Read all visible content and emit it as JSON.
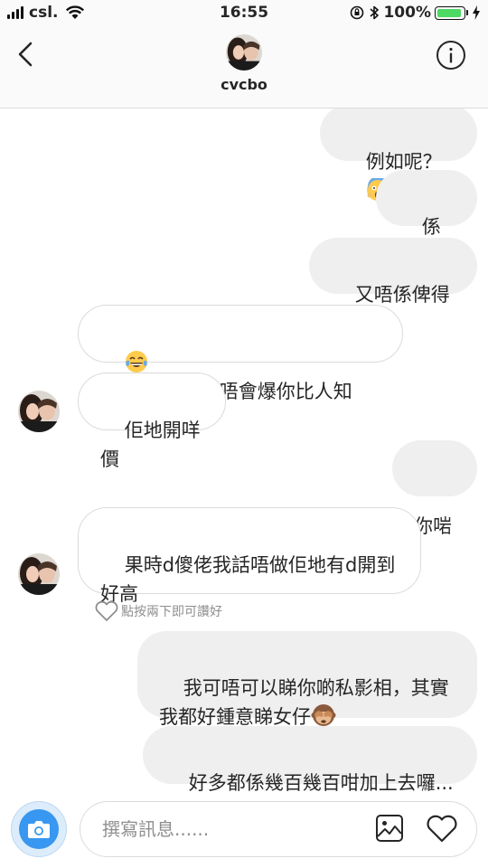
{
  "status_bar": {
    "carrier": "csl.",
    "time": "16:55",
    "battery_percent": "100%",
    "battery_level": 1.0
  },
  "header": {
    "username": "cvcbo"
  },
  "messages": [
    {
      "side": "out",
      "text": "例如呢？",
      "emoji": "scream-emoji"
    },
    {
      "side": "out",
      "text": "係呀..."
    },
    {
      "side": "out",
      "text": "又唔係俾得多"
    },
    {
      "side": "in",
      "text": "機密，我都唔會爆你比人知",
      "emoji": "tears-of-joy-emoji"
    },
    {
      "side": "in",
      "text": "佢地開咩價"
    },
    {
      "side": "out",
      "text": "你啱"
    },
    {
      "side": "in",
      "text": "果時d傻佬我話唔做佢地有d開到\n好高"
    },
    {
      "side": "out",
      "text": "我可唔可以睇你啲私影相，其實\n我都好鍾意睇女仔",
      "emoji": "see-no-evil-monkey-emoji"
    },
    {
      "side": "out",
      "text": "好多都係幾百幾百咁加上去囉..."
    }
  ],
  "like_hint": "點按兩下即可讚好",
  "composer": {
    "placeholder": "撰寫訊息......"
  },
  "colors": {
    "accent": "#3897f0",
    "outgoing_bubble": "#efefef",
    "battery": "#4cd964"
  }
}
